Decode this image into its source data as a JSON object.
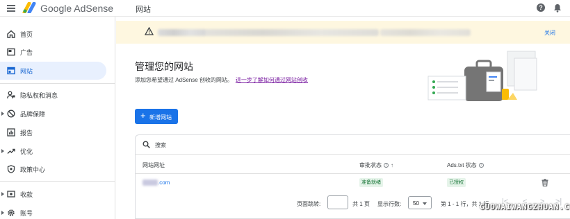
{
  "app": {
    "brand": "Google AdSense",
    "page_title": "网站"
  },
  "sidebar": {
    "items": [
      {
        "label": "首页",
        "icon": "home-icon"
      },
      {
        "label": "广告",
        "icon": "ads-icon"
      },
      {
        "label": "网站",
        "icon": "sites-icon",
        "active": true
      },
      {
        "label": "隐私权和消息",
        "icon": "privacy-icon"
      },
      {
        "label": "品牌保障",
        "icon": "block-icon",
        "expandable": true
      },
      {
        "label": "报告",
        "icon": "reports-icon"
      },
      {
        "label": "优化",
        "icon": "optimize-icon",
        "expandable": true
      },
      {
        "label": "政策中心",
        "icon": "policy-icon"
      },
      {
        "label": "收款",
        "icon": "payments-icon",
        "expandable": true
      },
      {
        "label": "账号",
        "icon": "gear-icon",
        "expandable": true
      }
    ]
  },
  "alert": {
    "close_label": "关闭"
  },
  "main": {
    "heading": "管理您的网站",
    "subtext": "添加您希望通过 AdSense 创收的网站。",
    "learn_more": "进一步了解如何通过网站创收",
    "add_button": "新增网站"
  },
  "table": {
    "search_placeholder": "搜索",
    "headers": {
      "url": "网站网址",
      "review": "审批状态",
      "ads_txt": "Ads.txt 状态"
    },
    "rows": [
      {
        "url_suffix": ".com",
        "review_status": "准备就绪",
        "ads_txt_status": "已授权"
      }
    ],
    "pagination": {
      "jump_label": "页面跳转:",
      "page_count": "共 1 页",
      "rows_label": "显示行数:",
      "rows_value": "50",
      "range": "第 1 - 1 行，共 1 行"
    }
  },
  "watermark": "GUOWAIWANGZHUAN.COM",
  "colors": {
    "primary": "#1a73e8",
    "alert_bg": "#fef7e0",
    "badge_bg": "#e6f4ea",
    "badge_text": "#137333",
    "link_visited": "#7b1fa2"
  }
}
